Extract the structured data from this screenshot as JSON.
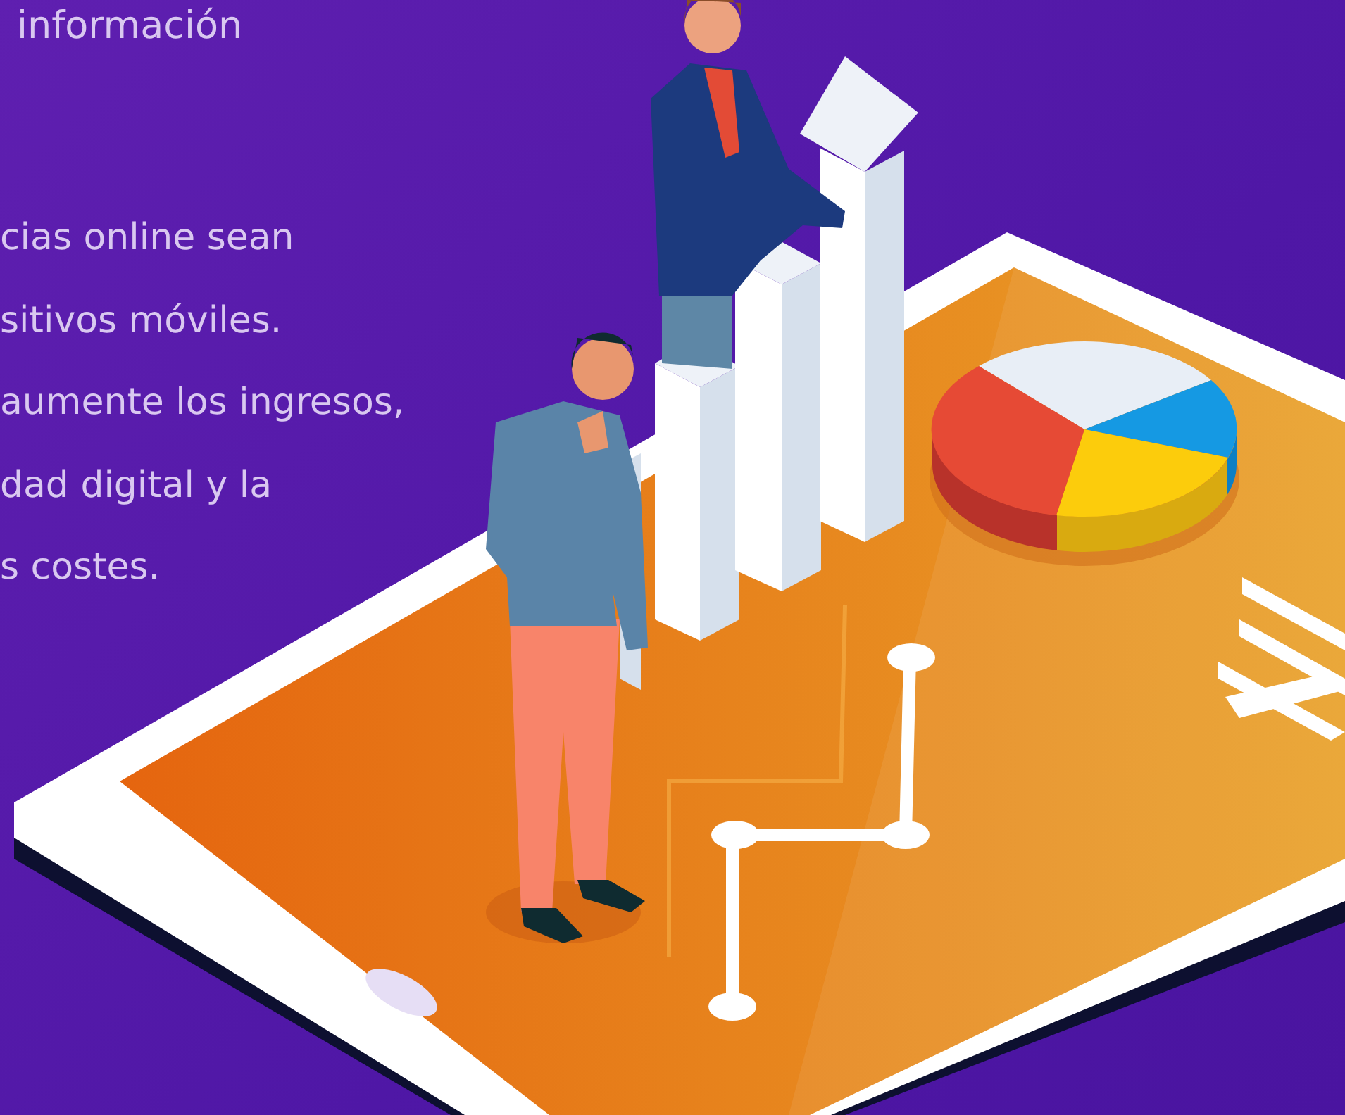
{
  "heading_fragment": "información",
  "paragraph_lines": [
    "cias online sean",
    "sitivos móviles.",
    "aumente los ingresos,",
    "dad digital y la",
    "s costes."
  ]
}
